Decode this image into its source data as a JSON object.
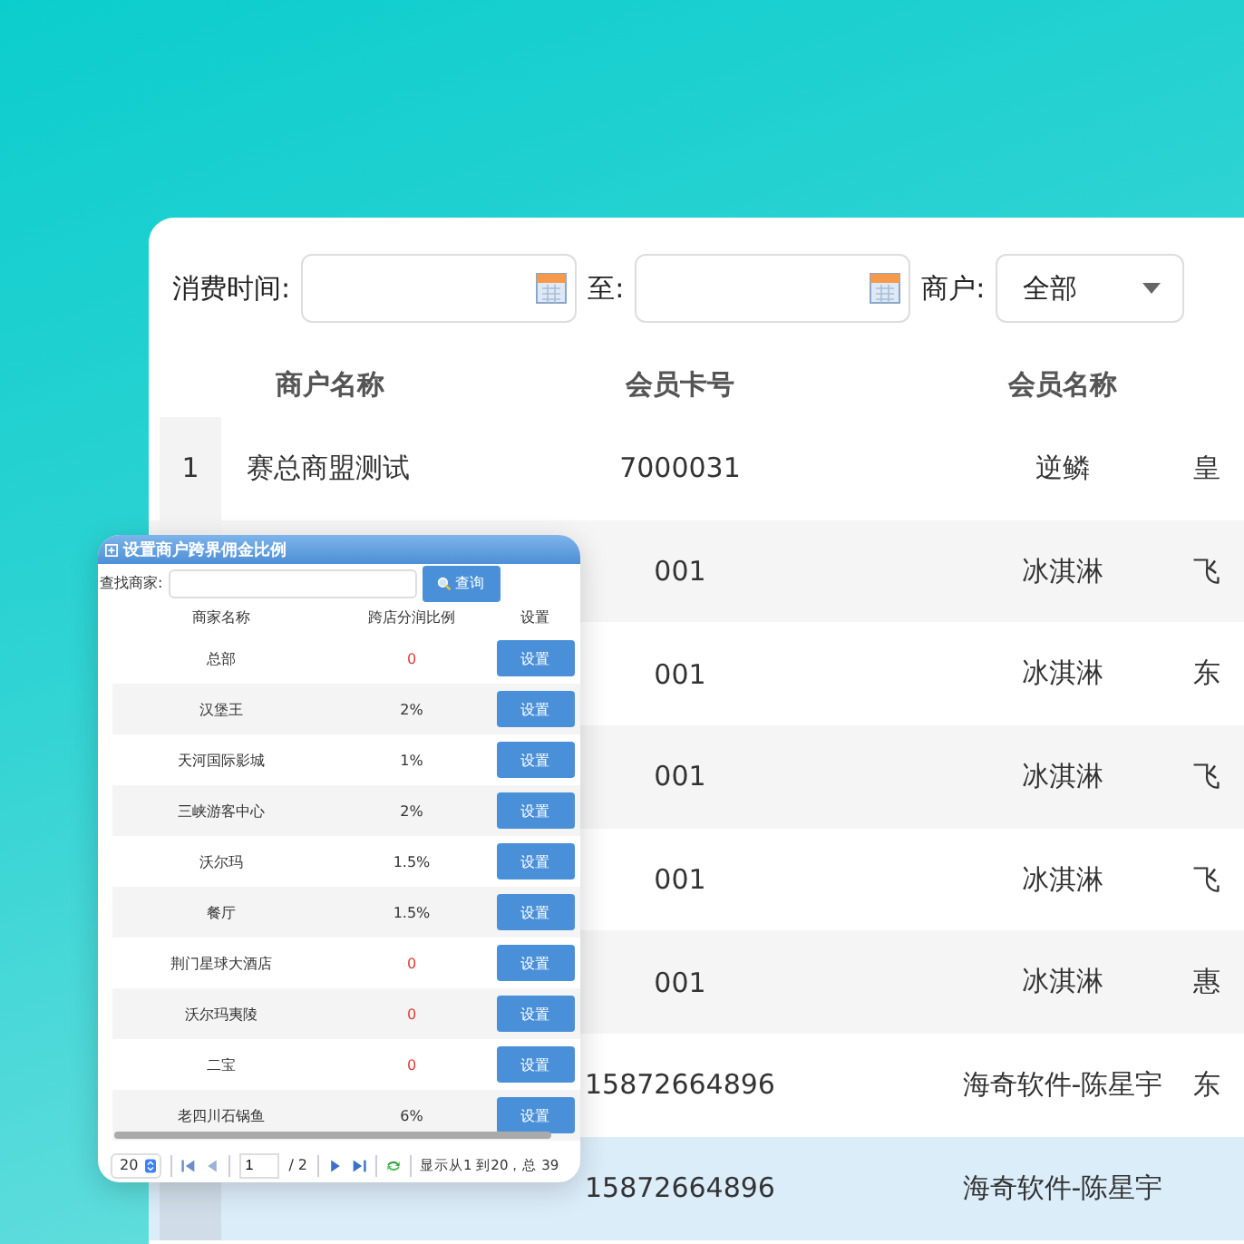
{
  "filters": {
    "time_label": "消费时间:",
    "to_label": "至:",
    "merchant_label": "商户:",
    "merchant_value": "全部"
  },
  "table": {
    "columns": [
      "商户名称",
      "会员卡号",
      "会员名称"
    ],
    "rows": [
      {
        "number": "1",
        "merchant": "赛总商盟测试",
        "card_no": "7000031",
        "member": "逆鳞",
        "column_4": "皇",
        "selected": false
      },
      {
        "card_no": "001",
        "member": "冰淇淋",
        "column_4": "飞",
        "selected": false
      },
      {
        "card_no": "001",
        "member": "冰淇淋",
        "column_4": "东",
        "selected": false
      },
      {
        "card_no": "001",
        "member": "冰淇淋",
        "column_4": "飞",
        "selected": false
      },
      {
        "card_no": "001",
        "member": "冰淇淋",
        "column_4": "飞",
        "selected": false
      },
      {
        "card_no": "001",
        "member": "冰淇淋",
        "column_4": "惠",
        "selected": false
      },
      {
        "card_no": "15872664896",
        "member": "海奇软件-陈星宇",
        "column_4": "东",
        "selected": false
      },
      {
        "card_no": "15872664896",
        "member": "海奇软件-陈星宇",
        "selected": true
      }
    ]
  },
  "dialog": {
    "title": "设置商户跨界佣金比例",
    "search_label": "查找商家:",
    "search_button": "查询",
    "columns": [
      "商家名称",
      "跨店分润比例",
      "设置"
    ],
    "rows": [
      {
        "name": "总部",
        "ratio": "0",
        "color": "#e53935",
        "button": "设置"
      },
      {
        "name": "汉堡王",
        "ratio": "2%",
        "color": "#333333",
        "button": "设置"
      },
      {
        "name": "天河国际影城",
        "ratio": "1%",
        "color": "#333333",
        "button": "设置"
      },
      {
        "name": "三峡游客中心",
        "ratio": "2%",
        "color": "#333333",
        "button": "设置"
      },
      {
        "name": "沃尔玛",
        "ratio": "1.5%",
        "color": "#333333",
        "button": "设置"
      },
      {
        "name": "餐厅",
        "ratio": "1.5%",
        "color": "#333333",
        "button": "设置"
      },
      {
        "name": "荆门星球大酒店",
        "ratio": "0",
        "color": "#e53935",
        "button": "设置"
      },
      {
        "name": "沃尔玛夷陵",
        "ratio": "0",
        "color": "#e53935",
        "button": "设置"
      },
      {
        "name": "二宝",
        "ratio": "0",
        "color": "#e53935",
        "button": "设置"
      },
      {
        "name": "老四川石锅鱼",
        "ratio": "6%",
        "color": "#333333",
        "button": "设置"
      }
    ],
    "pager": {
      "page_size": "20",
      "page": "1",
      "total_pages": "/ 2",
      "summary": "显示从1 到20，总 39"
    }
  }
}
